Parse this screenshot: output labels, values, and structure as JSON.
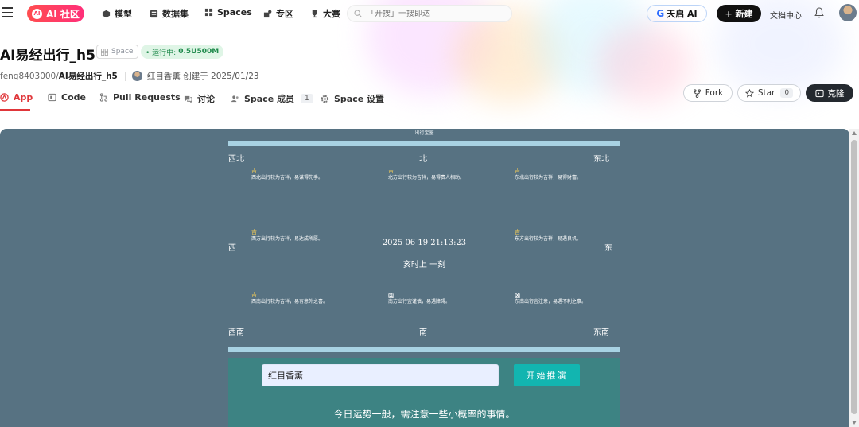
{
  "nav": {
    "logo": "AI 社区",
    "logo_mark": "AI",
    "items": [
      "模型",
      "数据集",
      "Spaces",
      "专区",
      "大赛"
    ],
    "search_placeholder": "「开搜」一搜即达",
    "tianqi_g": "G",
    "tianqi_label": "天启 AI",
    "new_label": "+ 新建",
    "docs_label": "文档中心"
  },
  "header": {
    "title": "AI易经出行_h5",
    "space_badge": "Space",
    "run_status": "• 运行中:",
    "run_spec": "0.5U500M",
    "owner": "feng8403000/",
    "repo": "AI易经出行_h5",
    "creator": "红目香薰 创建于 2025/01/23"
  },
  "tabs": [
    {
      "label": "App"
    },
    {
      "label": "Code"
    },
    {
      "label": "Pull Requests"
    },
    {
      "label": "讨论"
    },
    {
      "label": "Space 成员",
      "count": "1"
    },
    {
      "label": "Space 设置"
    }
  ],
  "actions": {
    "fork": "Fork",
    "star": "Star",
    "star_count": "0",
    "clone": "克隆"
  },
  "app": {
    "small_title": "出行宝鉴",
    "directions": {
      "nw": "西北",
      "n": "北",
      "ne": "东北",
      "w": "西",
      "e": "东",
      "sw": "西南",
      "s": "南",
      "se": "东南"
    },
    "cells": {
      "nw": {
        "fortune": "吉",
        "desc": "西北出行较为吉祥，易谋得先手。"
      },
      "n": {
        "fortune": "吉",
        "desc": "北方出行较为吉祥，易得贵人相助。"
      },
      "ne": {
        "fortune": "吉",
        "desc": "东北出行较为吉祥，易得财富。"
      },
      "w": {
        "fortune": "吉",
        "desc": "西方出行较为吉祥，易达成所愿。"
      },
      "e": {
        "fortune": "吉",
        "desc": "东方出行较为吉祥，易遇良机。"
      },
      "sw": {
        "fortune": "吉",
        "desc": "西南出行较为吉祥，易有意外之喜。"
      },
      "s": {
        "fortune": "凶",
        "desc": "南方出行宜谨慎，易遇障碍。"
      },
      "se": {
        "fortune": "凶",
        "desc": "东南出行宜注意，易遇不利之事。"
      }
    },
    "datetime": "2025 06 19 21:13:23",
    "shichen": "亥时上 一刻",
    "input_value": "红目香薰",
    "start_label": "开始推演",
    "result": "今日运势一般，需注意一些小概率的事情。"
  },
  "colors": {
    "accent": "#e0363a",
    "app_bg": "#577282",
    "panel_bg": "#3d8383",
    "start_btn": "#12b5b0",
    "bar": "#a8d2e3",
    "fortune_good": "#e8c65a"
  }
}
